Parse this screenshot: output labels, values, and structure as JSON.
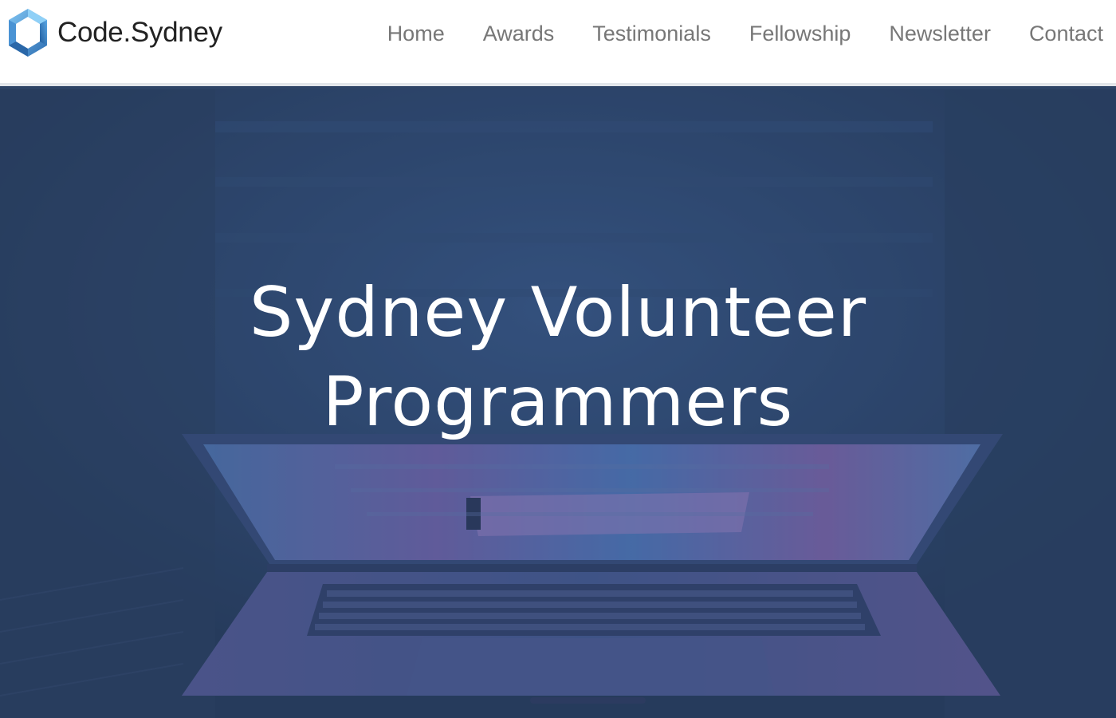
{
  "brand": {
    "name": "Code.Sydney",
    "logo_icon": "hexagon-logo-icon"
  },
  "nav": {
    "items": [
      {
        "label": "Home"
      },
      {
        "label": "Awards"
      },
      {
        "label": "Testimonials"
      },
      {
        "label": "Fellowship"
      },
      {
        "label": "Newsletter"
      },
      {
        "label": "Contact"
      }
    ]
  },
  "hero": {
    "heading_line1": "Sydney Volunteer",
    "heading_line2": "Programmers",
    "background_image": "laptop-photo"
  },
  "colors": {
    "nav_background": "#ffffff",
    "nav_link": "#777777",
    "brand_text": "#222222",
    "logo_blue": "#3b82c4",
    "hero_overlay": "#2e4466",
    "hero_text": "#ffffff"
  }
}
